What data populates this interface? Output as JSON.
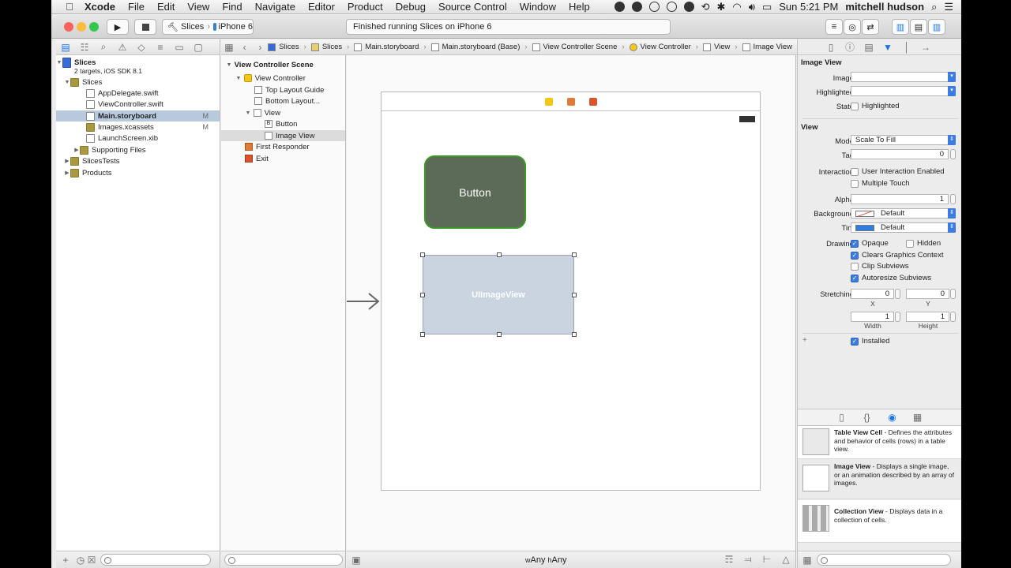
{
  "menubar": {
    "apple": "",
    "items": [
      "Xcode",
      "File",
      "Edit",
      "View",
      "Find",
      "Navigate",
      "Editor",
      "Product",
      "Debug",
      "Source Control",
      "Window",
      "Help"
    ],
    "clock": "Sun 5:21 PM",
    "user": "mitchell hudson"
  },
  "toolbar": {
    "scheme_target": "Slices",
    "scheme_device": "iPhone 6",
    "status": "Finished running Slices on iPhone 6",
    "traffic_colors": [
      "#fc605b",
      "#fdbc40",
      "#34c84a"
    ]
  },
  "navigator": {
    "project_name": "Slices",
    "project_sub": "2 targets, iOS SDK 8.1",
    "group_slices": "Slices",
    "files": [
      {
        "name": "AppDelegate.swift",
        "badge": ""
      },
      {
        "name": "ViewController.swift",
        "badge": ""
      },
      {
        "name": "Main.storyboard",
        "badge": "M"
      },
      {
        "name": "Images.xcassets",
        "badge": "M"
      },
      {
        "name": "LaunchScreen.xib",
        "badge": ""
      }
    ],
    "supporting": "Supporting Files",
    "tests": "SlicesTests",
    "products": "Products"
  },
  "breadcrumb": [
    "Slices",
    "Slices",
    "Main.storyboard",
    "Main.storyboard (Base)",
    "View Controller Scene",
    "View Controller",
    "View",
    "Image View"
  ],
  "outline": {
    "scene": "View Controller Scene",
    "vc": "View Controller",
    "top_guide": "Top Layout Guide",
    "bottom_guide": "Bottom Layout...",
    "view": "View",
    "button": "Button",
    "image_view": "Image View",
    "first_responder": "First Responder",
    "exit": "Exit"
  },
  "canvas": {
    "button_label": "Button",
    "imageview_label": "UIImageView",
    "size_w": "w",
    "size_w_val": "Any",
    "size_h": "h",
    "size_h_val": "Any"
  },
  "inspector": {
    "section_imageview": "Image View",
    "image_label": "Image",
    "highlighted_label": "Highlighted",
    "state_label": "State",
    "state_highlighted": "Highlighted",
    "section_view": "View",
    "mode_label": "Mode",
    "mode_value": "Scale To Fill",
    "tag_label": "Tag",
    "tag_value": "0",
    "interaction_label": "Interaction",
    "user_interaction": "User Interaction Enabled",
    "multiple_touch": "Multiple Touch",
    "alpha_label": "Alpha",
    "alpha_value": "1",
    "background_label": "Background",
    "background_value": "Default",
    "tint_label": "Tint",
    "tint_value": "Default",
    "tint_color": "#2f7de0",
    "drawing_label": "Drawing",
    "opaque": "Opaque",
    "hidden": "Hidden",
    "clears_graphics": "Clears Graphics Context",
    "clip_subviews": "Clip Subviews",
    "autoresize_subviews": "Autoresize Subviews",
    "stretching_label": "Stretching",
    "stretch_x": "0",
    "stretch_y": "0",
    "stretch_w": "1",
    "stretch_h": "1",
    "x_label": "X",
    "y_label": "Y",
    "width_label": "Width",
    "height_label": "Height",
    "installed": "Installed",
    "plus": "+"
  },
  "library": [
    {
      "title": "Table View Cell",
      "desc": " - Defines the attributes and behavior of cells (rows) in a table view."
    },
    {
      "title": "Image View",
      "desc": " - Displays a single image, or an animation described by an array of images."
    },
    {
      "title": "Collection View",
      "desc": " - Displays data in a collection of cells."
    }
  ]
}
